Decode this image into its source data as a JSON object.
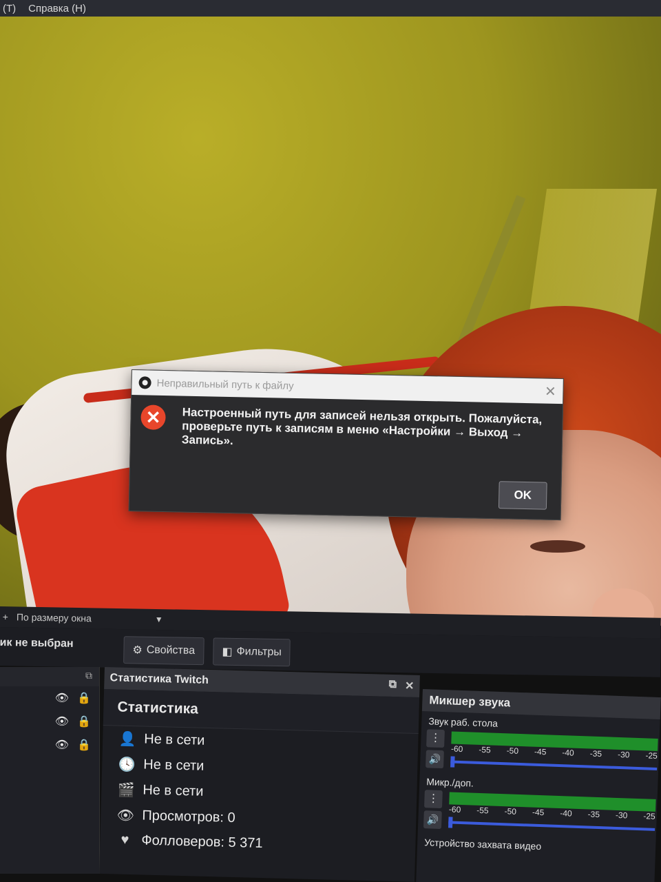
{
  "menubar": {
    "items": [
      "(Т)",
      "Справка (Н)"
    ]
  },
  "dialog": {
    "title": "Неправильный путь к файлу",
    "message": "Настроенный путь для записей нельзя открыть. Пожалуйста, проверьте путь к записям в меню «Настройки → Выход → Запись».",
    "ok_label": "OK"
  },
  "scalebar": {
    "add": "+",
    "label": "По размеру окна",
    "arrow": "▼"
  },
  "source_bar": {
    "status": "ик не выбран",
    "properties_label": "Свойства",
    "filters_label": "Фильтры"
  },
  "stats_panel": {
    "dock_title": "Статистика Twitch",
    "title": "Статистика",
    "rows": [
      {
        "icon": "user-icon",
        "text": "Не в сети"
      },
      {
        "icon": "clock-icon",
        "text": "Не в сети"
      },
      {
        "icon": "clapper-icon",
        "text": "Не в сети"
      },
      {
        "icon": "eye-icon",
        "text": "Просмотров: 0"
      },
      {
        "icon": "heart-icon",
        "text": "Фолловеров: 5 371"
      }
    ]
  },
  "mixer": {
    "title": "Микшер звука",
    "ticks": [
      "-60",
      "-55",
      "-50",
      "-45",
      "-40",
      "-35",
      "-30",
      "-25"
    ],
    "channels": [
      {
        "name": "Звук раб. стола"
      },
      {
        "name": "Микр./доп."
      },
      {
        "name": "Устройство захвата видео"
      }
    ]
  },
  "colors": {
    "error_red": "#e8462b",
    "meter_green": "#1f8f2a",
    "slider_blue": "#3b5bdc"
  }
}
